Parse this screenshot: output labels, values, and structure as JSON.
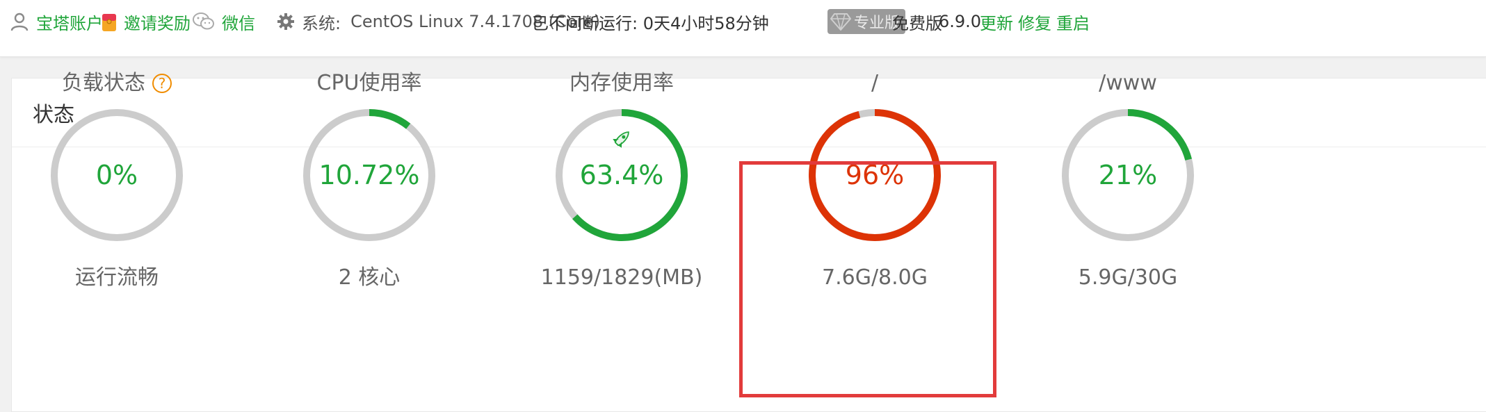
{
  "topbar": {
    "account_label": "宝塔账户",
    "invite_label": "邀请奖励",
    "wechat_label": "微信",
    "system_prefix": "系统:",
    "system_value": "CentOS Linux 7.4.1708 (Core)",
    "uptime_label": "已不间断运行: 0天4小时58分钟",
    "pro_label": "专业版",
    "free_label": "免费版",
    "version": "6.9.0",
    "update_label": "更新",
    "repair_label": "修复",
    "restart_label": "重启"
  },
  "panel": {
    "title": "状态"
  },
  "gauges": [
    {
      "title": "负载状态",
      "value_text": "0%",
      "percent": 0,
      "subtitle": "运行流畅",
      "color": "#20a53a",
      "help": "?"
    },
    {
      "title": "CPU使用率",
      "value_text": "10.72%",
      "percent": 10.72,
      "subtitle": "2 核心",
      "color": "#20a53a"
    },
    {
      "title": "内存使用率",
      "value_text": "63.4%",
      "percent": 63.4,
      "subtitle": "1159/1829(MB)",
      "color": "#20a53a",
      "icon": "rocket-icon"
    },
    {
      "title": "/",
      "value_text": "96%",
      "percent": 96,
      "subtitle": "7.6G/8.0G",
      "color": "#dd3306"
    },
    {
      "title": "/www",
      "value_text": "21%",
      "percent": 21,
      "subtitle": "5.9G/30G",
      "color": "#20a53a"
    }
  ],
  "colors": {
    "accent": "#20a53a",
    "danger": "#dd3306",
    "track": "#cccccc",
    "highlight": "#e23b3b"
  }
}
